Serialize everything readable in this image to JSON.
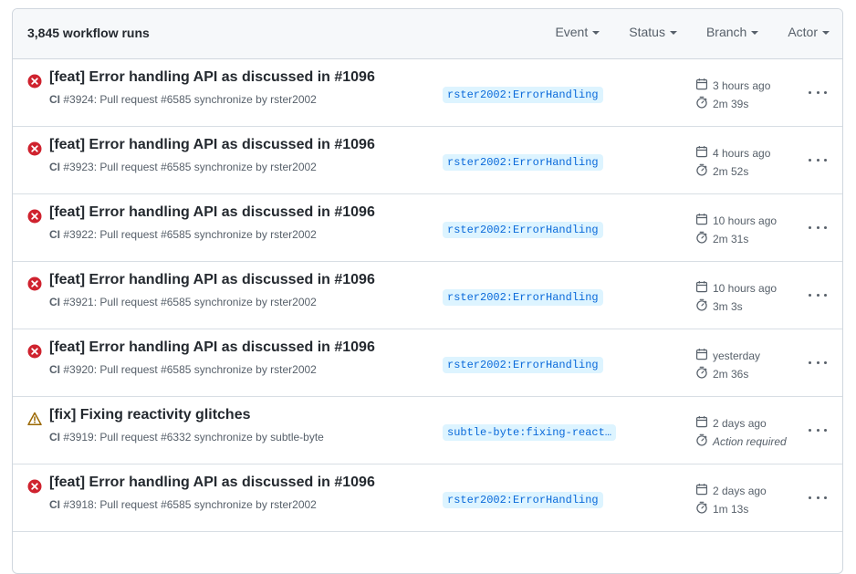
{
  "header": {
    "run_count": "3,845 workflow runs",
    "filters": [
      "Event",
      "Status",
      "Branch",
      "Actor"
    ]
  },
  "colors": {
    "failure": "#cf222e",
    "warning": "#9a6700",
    "branch_bg": "#ddf4ff",
    "branch_text": "#0969da"
  },
  "runs": [
    {
      "status": "failure-icon",
      "title": "[feat] Error handling API as discussed in #1096",
      "workflow": "CI",
      "detail": "#3924: Pull request #6585 synchronize by rster2002",
      "branch": "rster2002:ErrorHandling",
      "when": "3 hours ago",
      "duration": "2m 39s"
    },
    {
      "status": "failure-icon",
      "title": "[feat] Error handling API as discussed in #1096",
      "workflow": "CI",
      "detail": "#3923: Pull request #6585 synchronize by rster2002",
      "branch": "rster2002:ErrorHandling",
      "when": "4 hours ago",
      "duration": "2m 52s"
    },
    {
      "status": "failure-icon",
      "title": "[feat] Error handling API as discussed in #1096",
      "workflow": "CI",
      "detail": "#3922: Pull request #6585 synchronize by rster2002",
      "branch": "rster2002:ErrorHandling",
      "when": "10 hours ago",
      "duration": "2m 31s"
    },
    {
      "status": "failure-icon",
      "title": "[feat] Error handling API as discussed in #1096",
      "workflow": "CI",
      "detail": "#3921: Pull request #6585 synchronize by rster2002",
      "branch": "rster2002:ErrorHandling",
      "when": "10 hours ago",
      "duration": "3m 3s"
    },
    {
      "status": "failure-icon",
      "title": "[feat] Error handling API as discussed in #1096",
      "workflow": "CI",
      "detail": "#3920: Pull request #6585 synchronize by rster2002",
      "branch": "rster2002:ErrorHandling",
      "when": "yesterday",
      "duration": "2m 36s"
    },
    {
      "status": "warning-icon",
      "title": "[fix] Fixing reactivity glitches",
      "workflow": "CI",
      "detail": "#3919: Pull request #6332 synchronize by subtle-byte",
      "branch": "subtle-byte:fixing-react…",
      "when": "2 days ago",
      "duration": "Action required",
      "duration_italic": true
    },
    {
      "status": "failure-icon",
      "title": "[feat] Error handling API as discussed in #1096",
      "workflow": "CI",
      "detail": "#3918: Pull request #6585 synchronize by rster2002",
      "branch": "rster2002:ErrorHandling",
      "when": "2 days ago",
      "duration": "1m 13s"
    }
  ]
}
